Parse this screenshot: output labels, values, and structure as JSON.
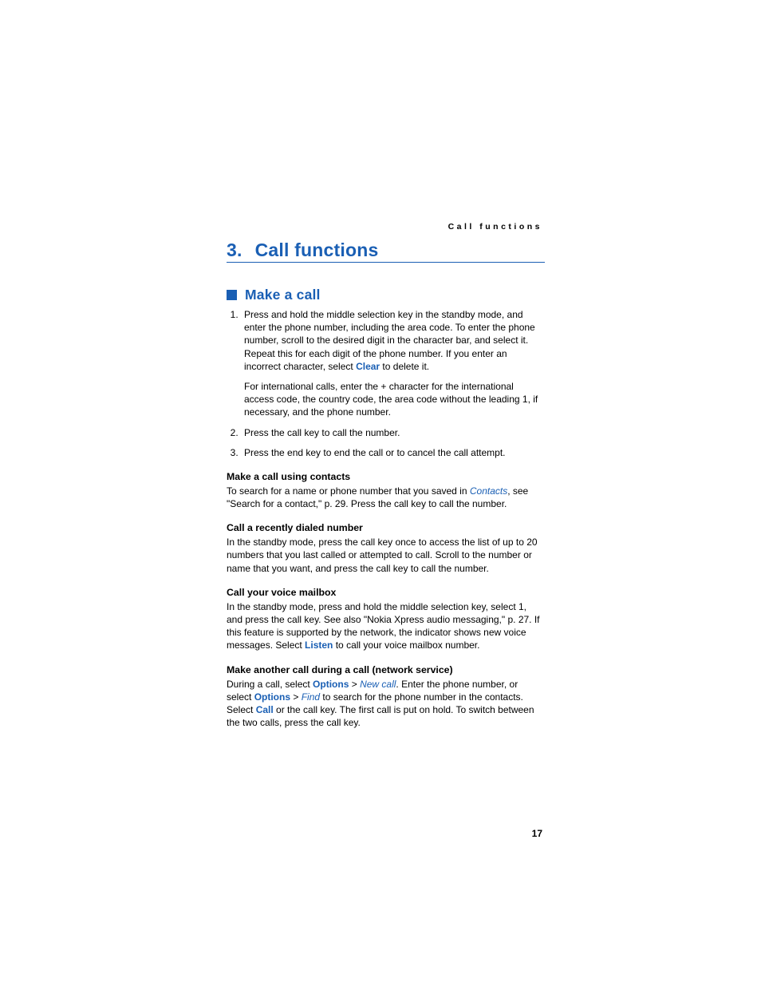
{
  "running_head": "Call functions",
  "chapter": {
    "number": "3.",
    "title": "Call functions"
  },
  "section": {
    "title": "Make a call",
    "steps": [
      {
        "text_before": "Press and hold the middle selection key in the standby mode, and enter the phone number, including the area code. To enter the phone number, scroll to the desired digit in the character bar, and select it. Repeat this for each digit of the phone number. If you enter an incorrect character, select ",
        "link": "Clear",
        "text_after": " to delete it.",
        "para2": "For international calls, enter the + character for the international access code, the country code, the area code without the leading 1, if necessary, and the phone number."
      },
      {
        "text": "Press the call key to call the number."
      },
      {
        "text": "Press the end key to end the call or to cancel the call attempt."
      }
    ],
    "sub1": {
      "head": "Make a call using contacts",
      "before": "To search for a name or phone number that you saved in ",
      "link": "Contacts",
      "after": ", see \"Search for a contact,\" p. 29. Press the call key to call the number."
    },
    "sub2": {
      "head": "Call a recently dialed number",
      "text": "In the standby mode, press the call key once to access the list of up to 20 numbers that you last called or attempted to call. Scroll to the number or name that you want, and press the call key to call the number."
    },
    "sub3": {
      "head": "Call your voice mailbox",
      "before": "In the standby mode, press and hold the middle selection key, select 1, and press the call key. See also \"Nokia Xpress audio messaging,\" p. 27. If this feature is supported by the network, the indicator shows new voice messages. Select ",
      "link": "Listen",
      "after": " to call your voice mailbox number."
    },
    "sub4": {
      "head": "Make another call during a call (network service)",
      "t1": "During a call, select ",
      "options1": "Options",
      "gt1": " > ",
      "newcall": "New call",
      "t2": ". Enter the phone number, or select ",
      "options2": "Options",
      "gt2": " > ",
      "find": "Find",
      "t3": " to search for the phone number in the contacts. Select ",
      "call": "Call",
      "t4": " or the call key. The first call is put on hold. To switch between the two calls, press the call key."
    }
  },
  "page_number": "17"
}
